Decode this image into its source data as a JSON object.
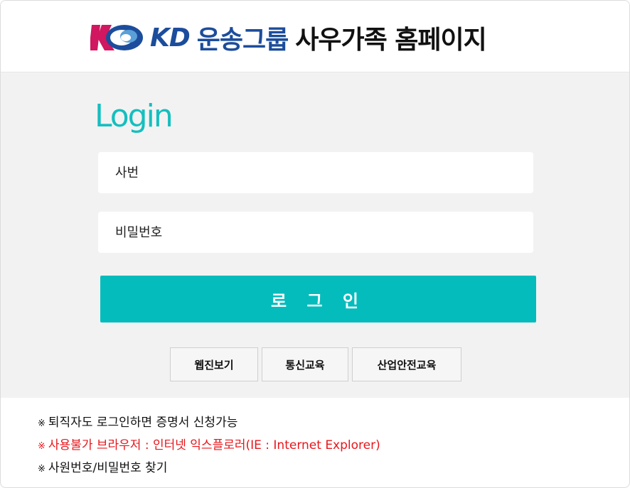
{
  "header": {
    "logo_icon": "kd-logo-icon",
    "brand": "KD",
    "brand_kor": "운송그룹",
    "title": "사우가족 홈페이지"
  },
  "login": {
    "title": "Login",
    "id_placeholder": "사번",
    "pw_placeholder": "비밀번호",
    "submit_label": "로 그 인"
  },
  "quick_links": [
    {
      "label": "웹진보기"
    },
    {
      "label": "통신교육"
    },
    {
      "label": "산업안전교육"
    }
  ],
  "notes": [
    {
      "mark": "※",
      "text": "퇴직자도 로그인하면 증명서 신청가능"
    },
    {
      "mark": "※",
      "text": "사용불가 브라우저 : 인터넷 익스플로러(IE : Internet Explorer)"
    },
    {
      "mark": "※",
      "text": "사원번호/비밀번호 찾기"
    }
  ],
  "colors": {
    "accent": "#05bcbd",
    "brand_blue": "#1c4d9c",
    "brand_magenta": "#d0175f",
    "warning_red": "#e8161b"
  }
}
